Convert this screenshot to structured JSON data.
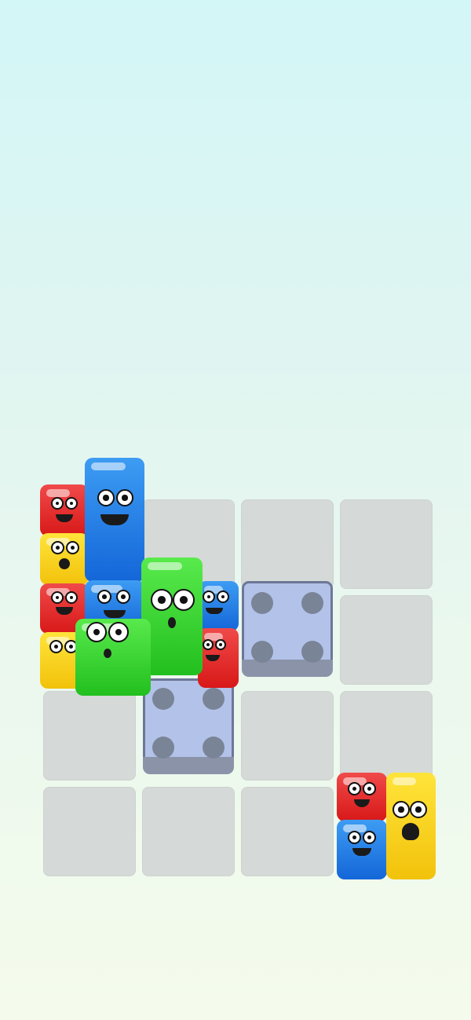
{
  "game": {
    "board": {
      "columns": 4,
      "rows": 4
    },
    "palette": {
      "red": "#e42a2a",
      "yellow": "#f8d323",
      "blue": "#1f7ae4",
      "green": "#34d52d",
      "cell": "#d5d9d7",
      "slot": "#b3c2e9"
    },
    "empty_slots": [
      {
        "id": "slot-r1-c2",
        "pips": 4
      },
      {
        "id": "slot-r2-c1",
        "pips": 4
      }
    ],
    "tray_piece": {
      "colors": [
        "red",
        "blue",
        "yellow"
      ]
    },
    "board_stack": {
      "colors": [
        "red",
        "yellow",
        "red",
        "yellow",
        "blue",
        "blue",
        "green",
        "blue",
        "red"
      ]
    }
  }
}
